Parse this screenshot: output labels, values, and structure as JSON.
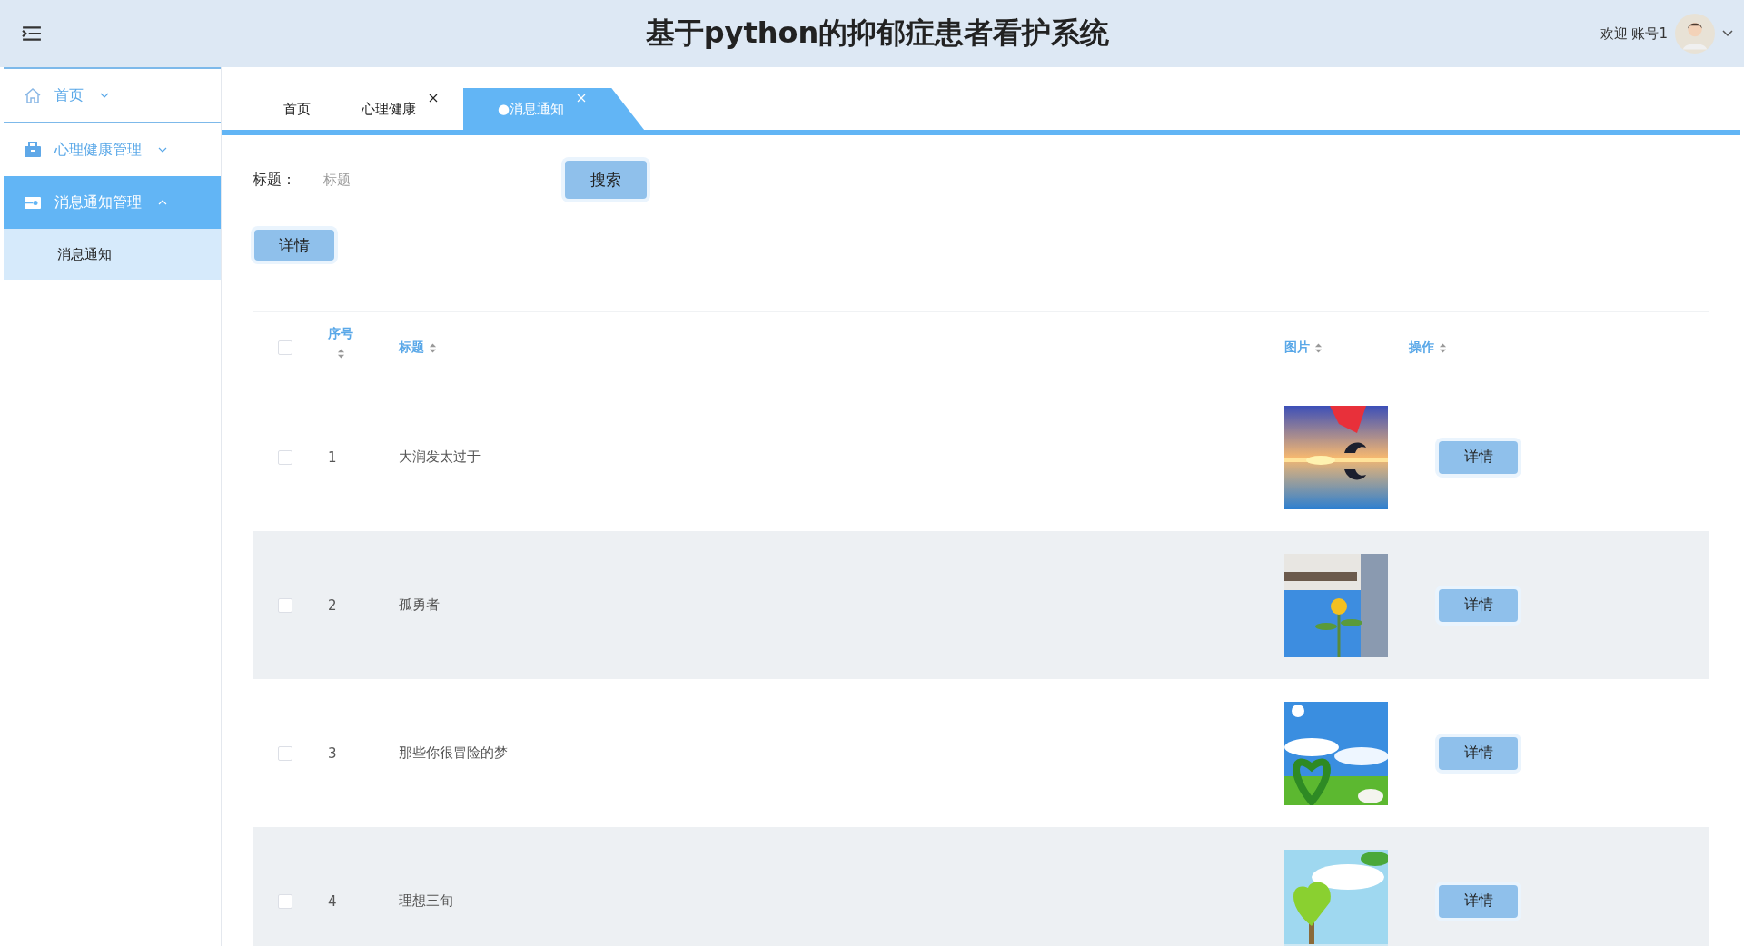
{
  "header": {
    "title": "基于python的抑郁症患者看护系统",
    "welcome": "欢迎 账号1"
  },
  "sidebar": {
    "items": [
      {
        "label": "首页",
        "expanded": false,
        "selected": false
      },
      {
        "label": "心理健康管理",
        "expanded": false,
        "selected": false
      },
      {
        "label": "消息通知管理",
        "expanded": true,
        "selected": true,
        "children": [
          {
            "label": "消息通知",
            "selected": true
          }
        ]
      }
    ]
  },
  "tabs": [
    {
      "label": "首页",
      "closable": false,
      "selected": false
    },
    {
      "label": "心理健康",
      "closable": true,
      "selected": false
    },
    {
      "label": "●消息通知",
      "closable": true,
      "selected": true
    }
  ],
  "search": {
    "label": "标题：",
    "placeholder": "标题",
    "button": "搜索"
  },
  "toolbar": {
    "detail_button": "详情"
  },
  "table": {
    "select_all": {
      "checked": false
    },
    "columns": [
      {
        "label": "序号"
      },
      {
        "label": "标题"
      },
      {
        "label": "图片"
      },
      {
        "label": "操作"
      }
    ],
    "rows": [
      {
        "checked": false,
        "index": "1",
        "title": "大润发太过于",
        "action": "详情"
      },
      {
        "checked": false,
        "index": "2",
        "title": "孤勇者",
        "action": "详情"
      },
      {
        "checked": false,
        "index": "3",
        "title": "那些你很冒险的梦",
        "action": "详情"
      },
      {
        "checked": false,
        "index": "4",
        "title": "理想三旬",
        "action": "详情"
      }
    ]
  }
}
